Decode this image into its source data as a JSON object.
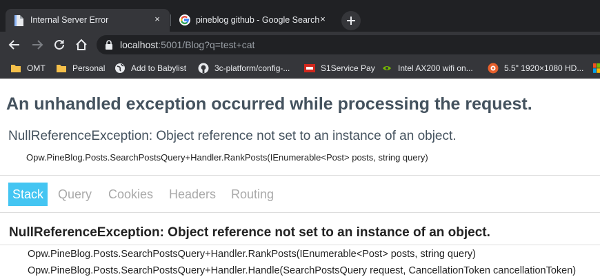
{
  "browser": {
    "tabs": [
      {
        "title": "Internal Server Error",
        "close": "×",
        "active": true
      },
      {
        "title": "pineblog github - Google Search",
        "close": "×",
        "active": false
      }
    ],
    "new_tab": "+",
    "address": {
      "host": "localhost",
      "path": ":5001/Blog?q=test+cat"
    },
    "bookmarks": [
      {
        "label": "OMT",
        "icon": "folder-icon"
      },
      {
        "label": "Personal",
        "icon": "folder-icon"
      },
      {
        "label": "Add to Babylist",
        "icon": "globe-icon"
      },
      {
        "label": "3c-platform/config-...",
        "icon": "github-icon"
      },
      {
        "label": "S1Service Pay",
        "icon": "adp-icon"
      },
      {
        "label": "Intel AX200 wifi on...",
        "icon": "nvidia-icon"
      },
      {
        "label": "5.5\" 1920×1080 HD...",
        "icon": "store-icon"
      }
    ]
  },
  "error_page": {
    "heading": "An unhandled exception occurred while processing the request.",
    "exception_title": "NullReferenceException: Object reference not set to an instance of an object.",
    "exception_location": "Opw.PineBlog.Posts.SearchPostsQuery+Handler.RankPosts(IEnumerable<Post> posts, string query)",
    "tabs": [
      "Stack",
      "Query",
      "Cookies",
      "Headers",
      "Routing"
    ],
    "selected_tab": "Stack",
    "stack_title": "NullReferenceException: Object reference not set to an instance of an object.",
    "stack_frames": [
      "Opw.PineBlog.Posts.SearchPostsQuery+Handler.RankPosts(IEnumerable<Post> posts, string query)",
      "Opw.PineBlog.Posts.SearchPostsQuery+Handler.Handle(SearchPostsQuery request, CancellationToken cancellationToken)"
    ]
  },
  "colors": {
    "chrome_dark": "#202124",
    "chrome_toolbar": "#35363a",
    "heading": "#44525e",
    "tab_selected": "#44c5f2",
    "tab_inactive": "#a9a9a9"
  }
}
